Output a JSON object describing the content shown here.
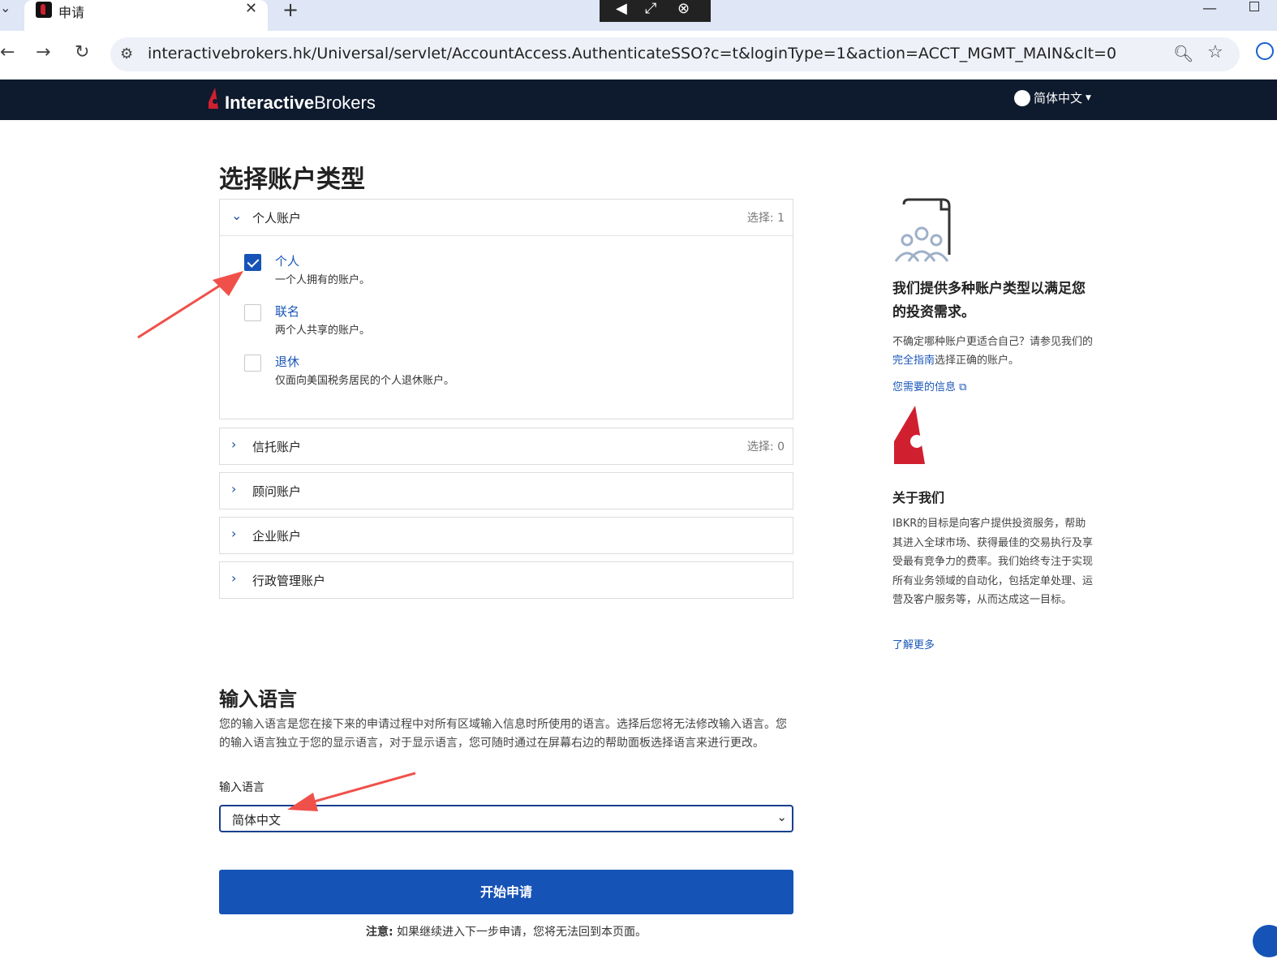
{
  "browser": {
    "tab_title": "申请",
    "tab_close": "✕",
    "new_tab": "+",
    "url": "interactivebrokers.hk/Universal/servlet/AccountAccess.AuthenticateSSO?c=t&loginType=1&action=ACCT_MGMT_MAIN&clt=0"
  },
  "header": {
    "logo_bold": "Interactive",
    "logo_light": "Brokers",
    "language": "简体中文"
  },
  "page": {
    "title": "选择账户类型",
    "panels": [
      {
        "title": "个人账户",
        "count": "选择: 1",
        "expanded": true,
        "options": [
          {
            "label": "个人",
            "desc": "一个人拥有的账户。",
            "checked": true
          },
          {
            "label": "联名",
            "desc": "两个人共享的账户。",
            "checked": false
          },
          {
            "label": "退休",
            "desc": "仅面向美国税务居民的个人退休账户。",
            "checked": false
          }
        ]
      },
      {
        "title": "信托账户",
        "count": "选择: 0",
        "expanded": false
      },
      {
        "title": "顾问账户",
        "count": "",
        "expanded": false
      },
      {
        "title": "企业账户",
        "count": "",
        "expanded": false
      },
      {
        "title": "行政管理账户",
        "count": "",
        "expanded": false
      }
    ],
    "input_lang": {
      "title": "输入语言",
      "desc": "您的输入语言是您在接下来的申请过程中对所有区域输入信息时所使用的语言。选择后您将无法修改输入语言。您的输入语言独立于您的显示语言，对于显示语言，您可随时通过在屏幕右边的帮助面板选择语言来进行更改。",
      "field_label": "输入语言",
      "selected": "简体中文"
    },
    "start_button": "开始申请",
    "note_bold": "注意:",
    "note_text": " 如果继续进入下一步申请，您将无法回到本页面。"
  },
  "aside": {
    "heading": "我们提供多种账户类型以满足您的投资需求。",
    "text_before": "不确定哪种账户更适合自己？请参见我们的",
    "text_link": "完全指南",
    "text_after": "选择正确的账户。",
    "info_link": "您需要的信息",
    "about_title": "关于我们",
    "about_text": "IBKR的目标是向客户提供投资服务，帮助其进入全球市场、获得最佳的交易执行及享受最有竞争力的费率。我们始终专注于实现所有业务领域的自动化，包括定单处理、运营及客户服务等，从而达成这一目标。",
    "learn_more": "了解更多"
  },
  "colors": {
    "primary": "#1653b6",
    "header_bg": "#0e1a2e",
    "brand_red": "#d0202f",
    "annotation_arrow": "#f0504a"
  }
}
